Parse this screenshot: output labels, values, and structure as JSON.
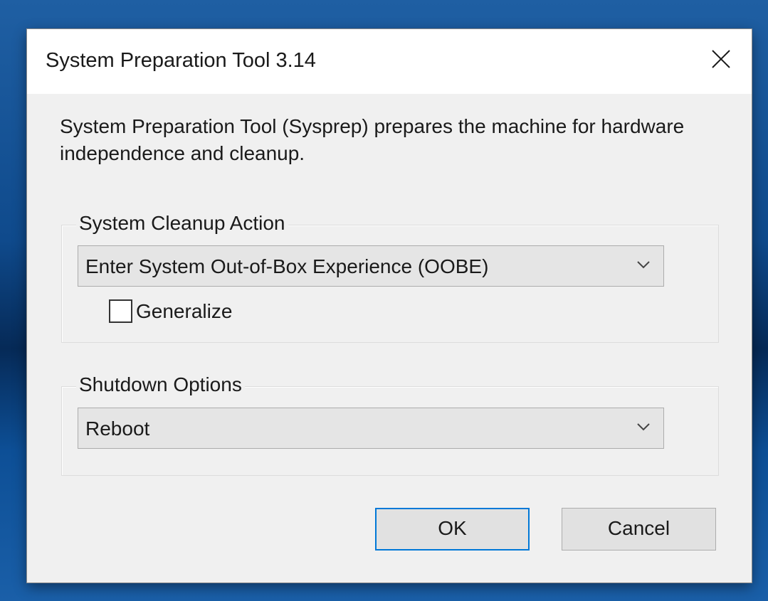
{
  "window": {
    "title": "System Preparation Tool 3.14",
    "close_icon": "close-icon"
  },
  "description": "System Preparation Tool (Sysprep) prepares the machine for hardware independence and cleanup.",
  "cleanup_group": {
    "label": "System Cleanup Action",
    "selected": "Enter System Out-of-Box Experience (OOBE)",
    "dropdown_icon": "chevron-down-icon",
    "generalize": {
      "label": "Generalize",
      "checked": false
    }
  },
  "shutdown_group": {
    "label": "Shutdown Options",
    "selected": "Reboot",
    "dropdown_icon": "chevron-down-icon"
  },
  "buttons": {
    "ok": "OK",
    "cancel": "Cancel"
  },
  "colors": {
    "focus_border": "#0078d7",
    "dialog_bg": "#f0f0f0",
    "titlebar_bg": "#ffffff",
    "desktop_bg": "#0f4a8c"
  }
}
